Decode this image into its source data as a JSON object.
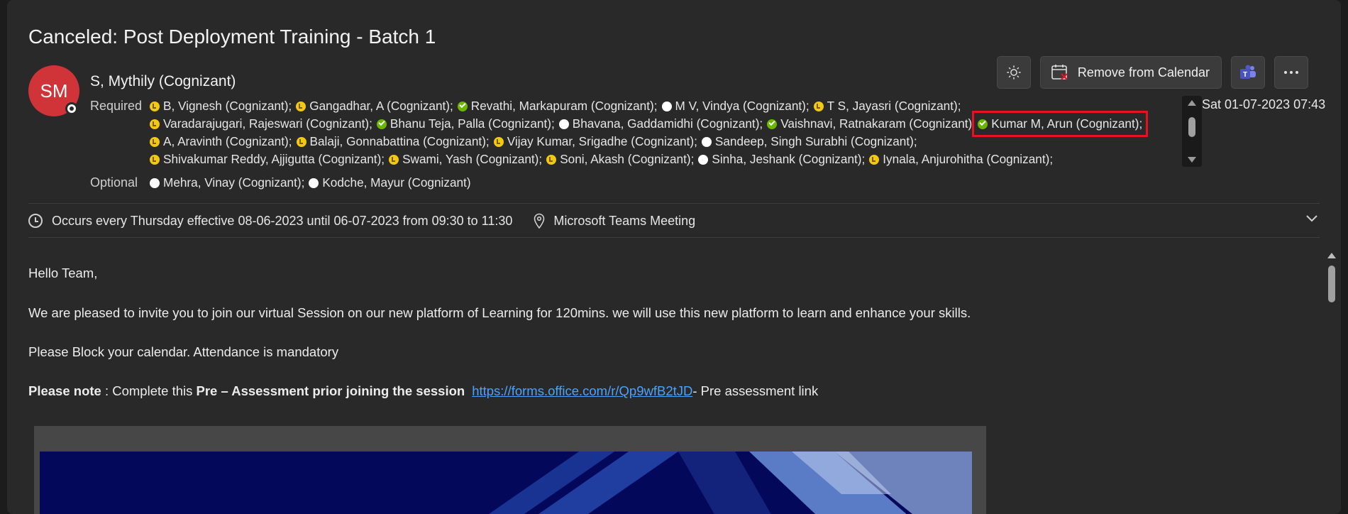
{
  "subject": "Canceled: Post Deployment Training - Batch 1",
  "sender": {
    "initials": "SM",
    "name": "S, Mythily (Cognizant)",
    "avatar_color": "#d13438"
  },
  "toolbar": {
    "remove_label": "Remove from Calendar"
  },
  "required_label": "Required",
  "optional_label": "Optional",
  "required_rows": [
    [
      {
        "name": "B, Vignesh (Cognizant);",
        "status": "tentative"
      },
      {
        "name": "Gangadhar, A (Cognizant);",
        "status": "tentative"
      },
      {
        "name": "Revathi, Markapuram (Cognizant);",
        "status": "accepted"
      },
      {
        "name": "M V, Vindya (Cognizant);",
        "status": "none"
      },
      {
        "name": "T S, Jayasri (Cognizant);",
        "status": "tentative"
      }
    ],
    [
      {
        "name": "Varadarajugari, Rajeswari (Cognizant);",
        "status": "tentative"
      },
      {
        "name": "Bhanu Teja, Palla (Cognizant);",
        "status": "accepted"
      },
      {
        "name": "Bhavana, Gaddamidhi (Cognizant);",
        "status": "none"
      },
      {
        "name": "Vaishnavi, Ratnakaram (Cognizant)",
        "status": "accepted"
      },
      {
        "name": "Kumar M, Arun (Cognizant);",
        "status": "accepted",
        "highlighted": true
      }
    ],
    [
      {
        "name": "A, Aravinth (Cognizant);",
        "status": "tentative"
      },
      {
        "name": "Balaji, Gonnabattina (Cognizant);",
        "status": "tentative"
      },
      {
        "name": "Vijay Kumar, Srigadhe (Cognizant);",
        "status": "tentative"
      },
      {
        "name": "Sandeep, Singh Surabhi (Cognizant);",
        "status": "none"
      }
    ],
    [
      {
        "name": "Shivakumar Reddy, Ajjigutta (Cognizant);",
        "status": "tentative"
      },
      {
        "name": "Swami, Yash (Cognizant);",
        "status": "tentative"
      },
      {
        "name": "Soni, Akash (Cognizant);",
        "status": "tentative"
      },
      {
        "name": "Sinha, Jeshank (Cognizant);",
        "status": "none"
      },
      {
        "name": "Iynala, Anjurohitha (Cognizant);",
        "status": "tentative"
      }
    ]
  ],
  "optional": [
    {
      "name": "Mehra, Vinay (Cognizant);",
      "status": "none"
    },
    {
      "name": "Kodche, Mayur (Cognizant)",
      "status": "none"
    }
  ],
  "date": "Sat 01-07-2023 07:43",
  "recurrence": "Occurs every Thursday effective 08-06-2023 until 06-07-2023 from 09:30 to 11:30",
  "location": "Microsoft Teams Meeting",
  "body": {
    "greeting": "Hello Team,",
    "para1": "We are pleased to invite you to join our virtual Session on our new platform of Learning for 120mins. we will use this new platform to learn and enhance your skills.",
    "para2": "Please Block your calendar. Attendance is mandatory",
    "note_bold": "Please note",
    "note_text1": " : Complete this ",
    "note_bold2": "Pre – Assessment prior joining the session",
    "note_link": "https://forms.office.com/r/Qp9wfB2tJD",
    "note_tail": "- Pre assessment link"
  },
  "icons": {
    "theme": "sun-icon",
    "remove": "calendar-remove-icon",
    "teams": "teams-icon",
    "more": "more-icon",
    "clock": "clock-icon",
    "location": "location-pin-icon",
    "expand": "chevron-down-icon"
  },
  "colors": {
    "tentative": "#f2c811",
    "accepted": "#6bb700",
    "highlight": "#e81123",
    "link": "#4aa3ff"
  }
}
